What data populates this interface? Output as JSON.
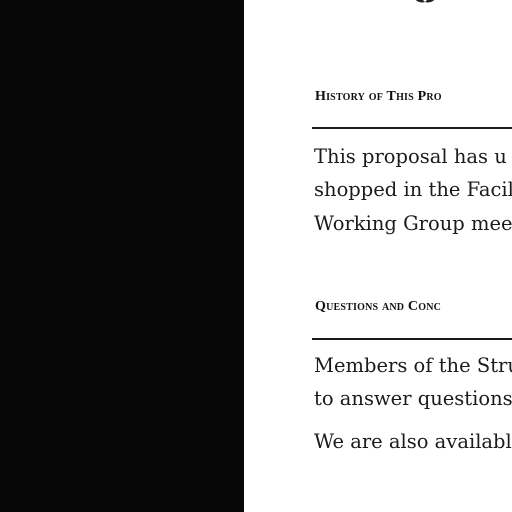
{
  "document": {
    "sections": [
      {
        "heading": "History of This Pro",
        "lines": [
          "This proposal has u",
          "shopped in the Facil",
          "Working Group mee"
        ]
      },
      {
        "heading": "Questions and Conc",
        "lines": [
          "Members of the Stru",
          "to answer questions"
        ]
      }
    ],
    "closing_line": "We are also availabl"
  },
  "icons": {
    "ornament": "decorative-ornament-icon"
  },
  "colors": {
    "left_band": "#070707",
    "page_background": "#ffffff",
    "text": "#1b1b1b"
  }
}
